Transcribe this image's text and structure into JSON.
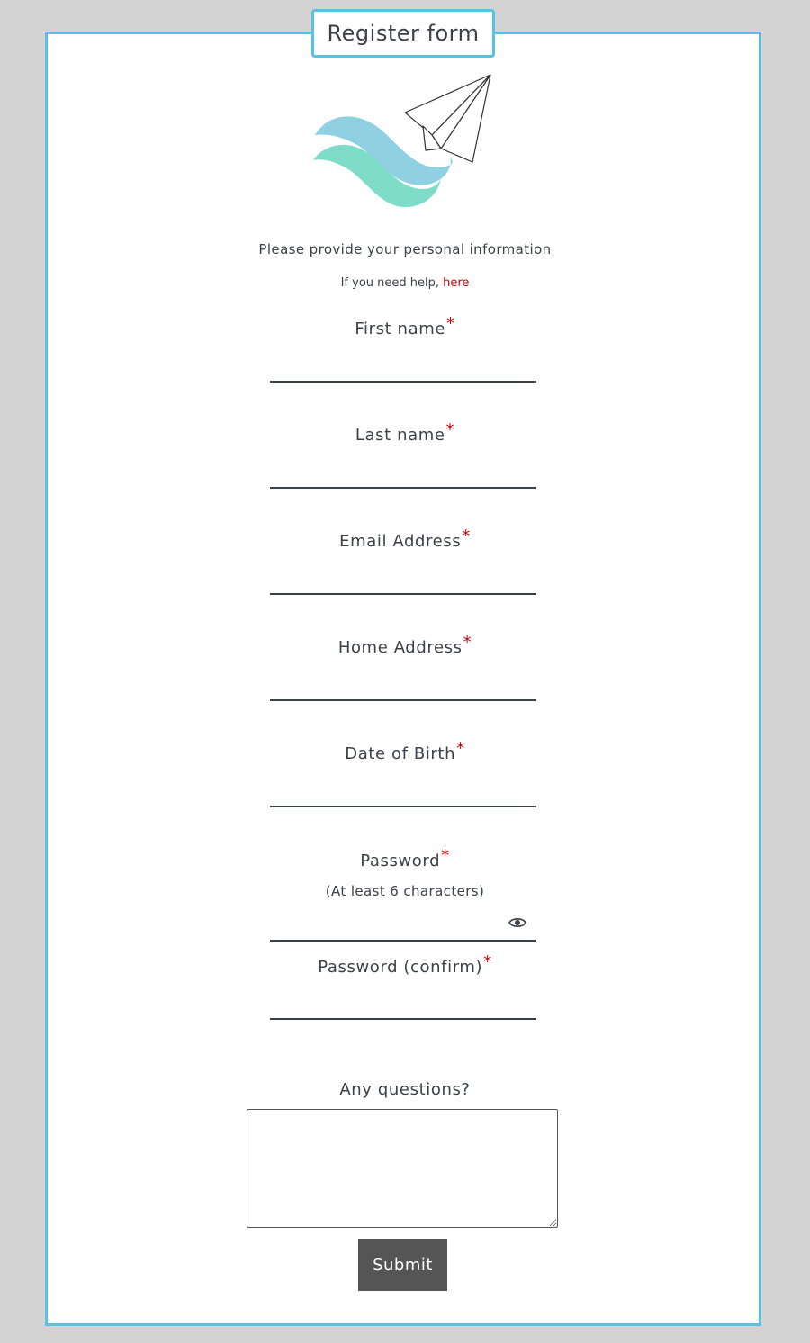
{
  "form": {
    "title": "Register form",
    "intro": "Please provide your personal information",
    "help_prefix": "If you need help, ",
    "help_link": "here",
    "required_mark": "*",
    "fields": [
      {
        "label": "First name",
        "required": true,
        "value": ""
      },
      {
        "label": "Last name",
        "required": true,
        "value": ""
      },
      {
        "label": "Email Address",
        "required": true,
        "value": ""
      },
      {
        "label": "Home Address",
        "required": true,
        "value": ""
      },
      {
        "label": "Date of Birth",
        "required": true,
        "value": ""
      },
      {
        "label": "Password",
        "required": true,
        "hint": "(At least 6 characters)",
        "value": ""
      },
      {
        "label": "Password (confirm)",
        "required": true,
        "value": ""
      }
    ],
    "questions_label": "Any questions?",
    "questions_value": "",
    "submit_label": "Submit"
  },
  "icons": {
    "logo": "paper-plane-waves-logo",
    "show_password": "eye-icon"
  },
  "colors": {
    "background": "#d3d3d3",
    "card_border": "#5bc0e6",
    "required": "#cc0000",
    "link": "#cc0000",
    "text": "#3b4148",
    "button": "#555555",
    "wave_blue": "#8fd0e3",
    "wave_teal": "#7fdcc8"
  }
}
